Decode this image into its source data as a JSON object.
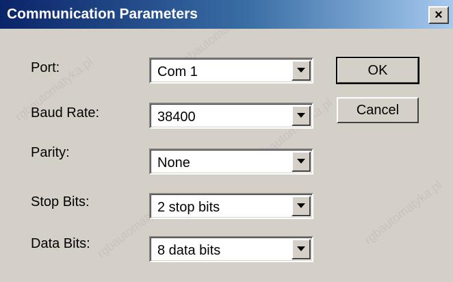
{
  "window": {
    "title": "Communication Parameters",
    "close_symbol": "×",
    "close_icon": "close-icon"
  },
  "fields": [
    {
      "label": "Port:",
      "value": "Com 1"
    },
    {
      "label": "Baud Rate:",
      "value": "38400"
    },
    {
      "label": "Parity:",
      "value": "None"
    },
    {
      "label": "Stop Bits:",
      "value": "2 stop bits"
    },
    {
      "label": "Data Bits:",
      "value": "8 data bits"
    }
  ],
  "buttons": {
    "ok_label": "OK",
    "cancel_label": "Cancel"
  },
  "watermark": {
    "text": "rgbautomatyka.pl"
  },
  "colors": {
    "titlebar_start": "#0a246a",
    "titlebar_end": "#a6caf0",
    "face": "#d4d0c8"
  }
}
